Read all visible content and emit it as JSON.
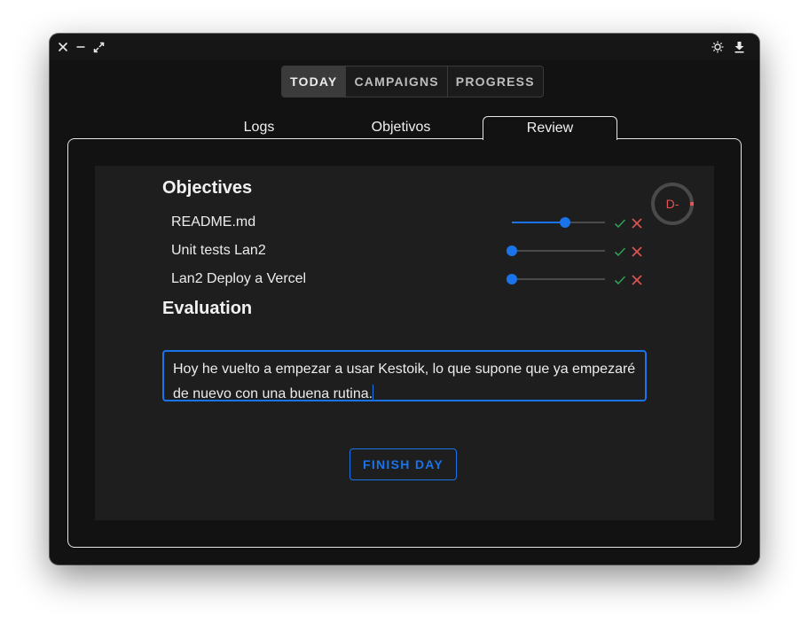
{
  "window": {
    "controls": {
      "close_icon": "close-icon",
      "minimize_icon": "minimize-icon",
      "maximize_icon": "maximize-icon"
    },
    "actions": {
      "theme_icon": "brightness-icon",
      "download_icon": "download-icon"
    }
  },
  "nav": {
    "segments": [
      "TODAY",
      "CAMPAIGNS",
      "PROGRESS"
    ],
    "active": "TODAY"
  },
  "tabs": {
    "items": [
      "Logs",
      "Objetivos",
      "Review"
    ],
    "active": "Review"
  },
  "review": {
    "objectives_title": "Objectives",
    "objectives": [
      {
        "label": "README.md",
        "progress": 0.57,
        "done_icon": "check-icon",
        "fail_icon": "x-icon"
      },
      {
        "label": "Unit tests Lan2",
        "progress": 0.0,
        "done_icon": "check-icon",
        "fail_icon": "x-icon"
      },
      {
        "label": "Lan2 Deploy a Vercel",
        "progress": 0.0,
        "done_icon": "check-icon",
        "fail_icon": "x-icon"
      }
    ],
    "grade": {
      "text": "D-",
      "progress": 0.0
    },
    "evaluation_title": "Evaluation",
    "evaluation_text": "Hoy he vuelto a empezar a usar Kestoik, lo que supone que ya empezaré de nuevo con una buena rutina.",
    "finish_label": "FINISH DAY"
  },
  "colors": {
    "accent": "#1a73e8",
    "success": "#2e9d4f",
    "danger": "#e05555",
    "background": "#121212",
    "card": "#1e1e1e"
  }
}
